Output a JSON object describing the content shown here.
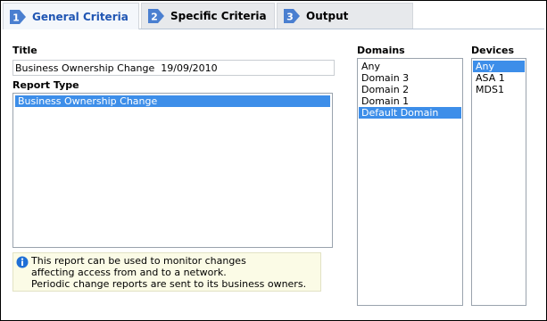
{
  "tabs": [
    {
      "number": "1",
      "label": "General Criteria",
      "active": true
    },
    {
      "number": "2",
      "label": "Specific Criteria",
      "active": false
    },
    {
      "number": "3",
      "label": "Output",
      "active": false
    }
  ],
  "title_field": {
    "label": "Title",
    "value": "Business Ownership Change  19/09/2010"
  },
  "report_type": {
    "label": "Report Type",
    "options": [
      "Business Ownership Change"
    ],
    "selected": "Business Ownership Change"
  },
  "info_box": {
    "icon": "info-icon",
    "lines": [
      "This report can be used to monitor changes",
      "affecting access from and to a network.",
      "Periodic change reports are sent to its business owners."
    ]
  },
  "domains": {
    "label": "Domains",
    "options": [
      "Any",
      "Domain 3",
      "Domain 2",
      "Domain 1",
      "Default Domain"
    ],
    "selected": "Default Domain"
  },
  "devices": {
    "label": "Devices",
    "options": [
      "Any",
      "ASA 1",
      "MDS1"
    ],
    "selected": "Any"
  },
  "colors": {
    "active_tab_text": "#1f55b3",
    "selection": "#3d8ee9",
    "step_badge": "#4a7fd0",
    "info_background": "#fbfbe6"
  }
}
